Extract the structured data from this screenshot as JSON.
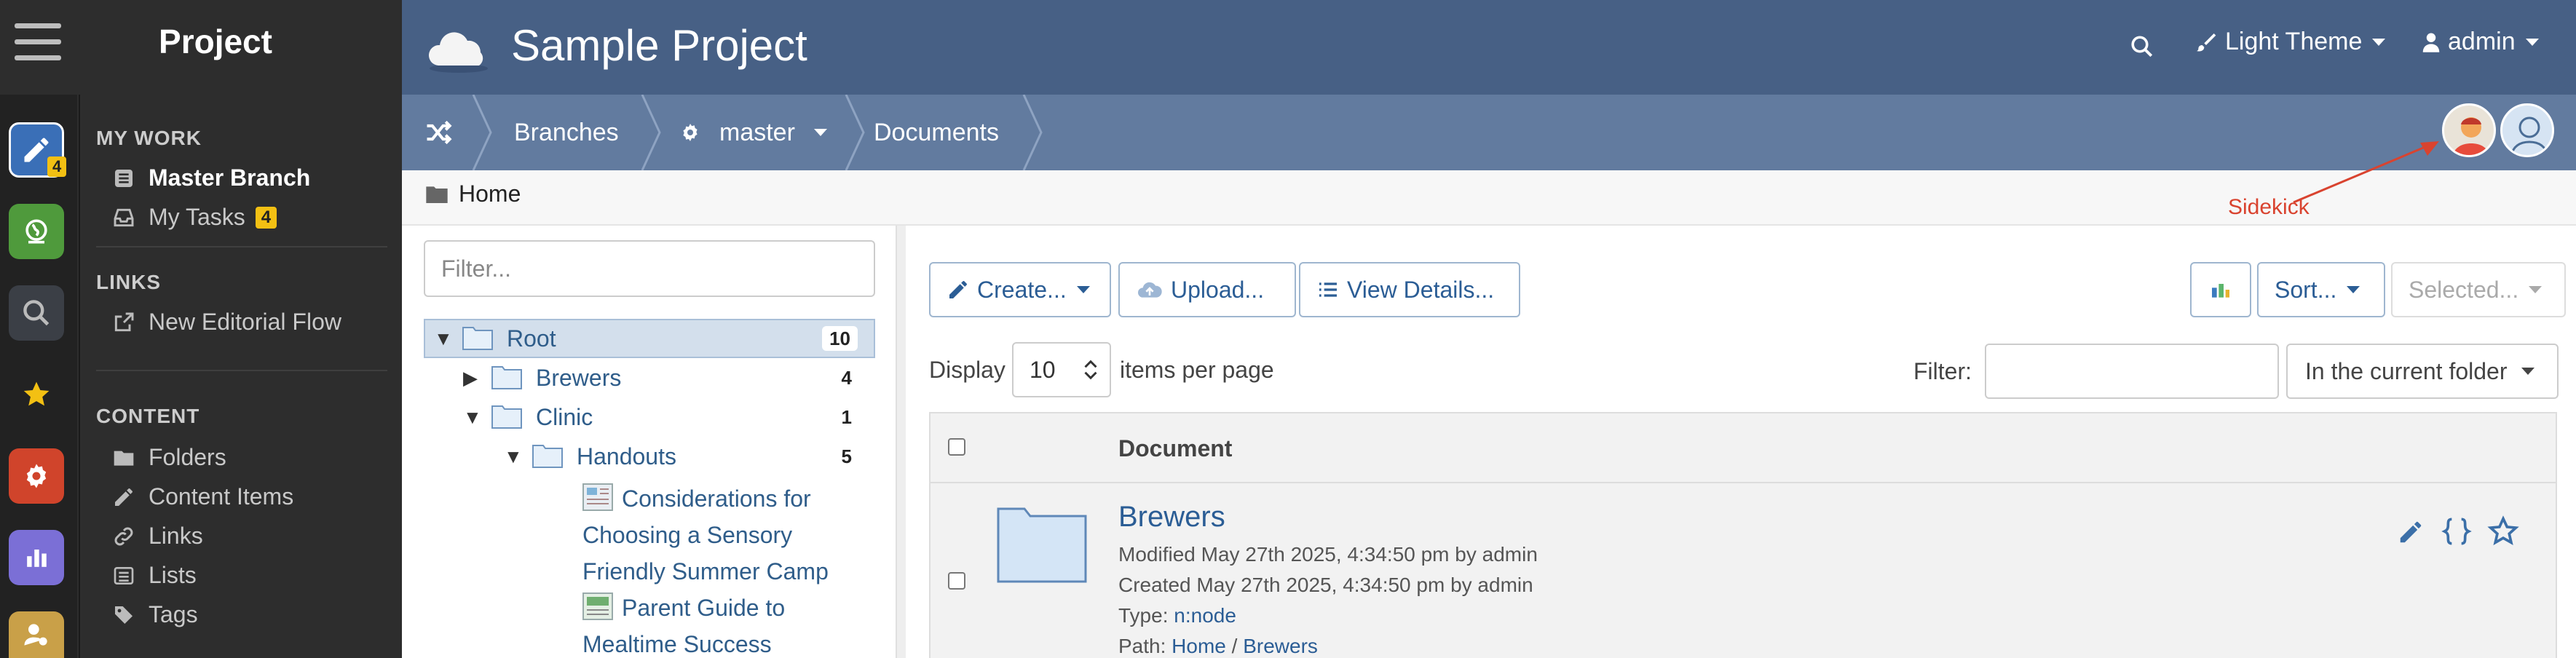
{
  "app": {
    "name": "Project",
    "title": "Sample Project"
  },
  "header": {
    "theme_label": "Light Theme",
    "user_label": "admin"
  },
  "sidebar": {
    "rail_badge": "4",
    "my_work": {
      "heading": "MY WORK",
      "items": [
        {
          "label": "Master Branch"
        },
        {
          "label": "My Tasks",
          "badge": "4"
        }
      ]
    },
    "links": {
      "heading": "LINKS",
      "items": [
        {
          "label": "New Editorial Flow"
        }
      ]
    },
    "content": {
      "heading": "CONTENT",
      "items": [
        {
          "label": "Folders"
        },
        {
          "label": "Content Items"
        },
        {
          "label": "Links"
        },
        {
          "label": "Lists"
        },
        {
          "label": "Tags"
        }
      ]
    }
  },
  "breadcrumb": {
    "branches": "Branches",
    "branch": "master",
    "documents": "Documents"
  },
  "annotation": {
    "sidekick": "Sidekick"
  },
  "home_label": "Home",
  "tree": {
    "filter_placeholder": "Filter...",
    "nodes": [
      {
        "label": "Root",
        "count": "10"
      },
      {
        "label": "Brewers",
        "count": "4"
      },
      {
        "label": "Clinic",
        "count": "1"
      },
      {
        "label": "Handouts",
        "count": "5"
      }
    ],
    "docs": [
      {
        "lines": [
          "Considerations for",
          "Choosing a Sensory",
          "Friendly Summer Camp"
        ]
      },
      {
        "lines": [
          "Parent Guide to",
          "Mealtime Success"
        ]
      }
    ]
  },
  "toolbar": {
    "create": "Create...",
    "upload": "Upload...",
    "view_details": "View Details...",
    "sort": "Sort...",
    "selected": "Selected..."
  },
  "paging": {
    "display_label": "Display",
    "per_page_value": "10",
    "per_page_suffix": "items per page",
    "filter_label": "Filter:",
    "scope": "In the current folder"
  },
  "grid": {
    "column_document": "Document",
    "rows": [
      {
        "title": "Brewers",
        "modified": "Modified May 27th 2025, 4:34:50 pm by admin",
        "created": "Created May 27th 2025, 4:34:50 pm by admin",
        "type_label": "Type:",
        "type_value": "n:node",
        "path_label": "Path:",
        "path_home": "Home",
        "path_sep": "/",
        "path_leaf": "Brewers"
      }
    ]
  },
  "colors": {
    "header": "#476085",
    "breadcrumb": "#627b9f",
    "sidebar": "#2d2d2d",
    "link": "#2b5d95",
    "badge": "#f3c013",
    "annotation": "#d9432f"
  }
}
